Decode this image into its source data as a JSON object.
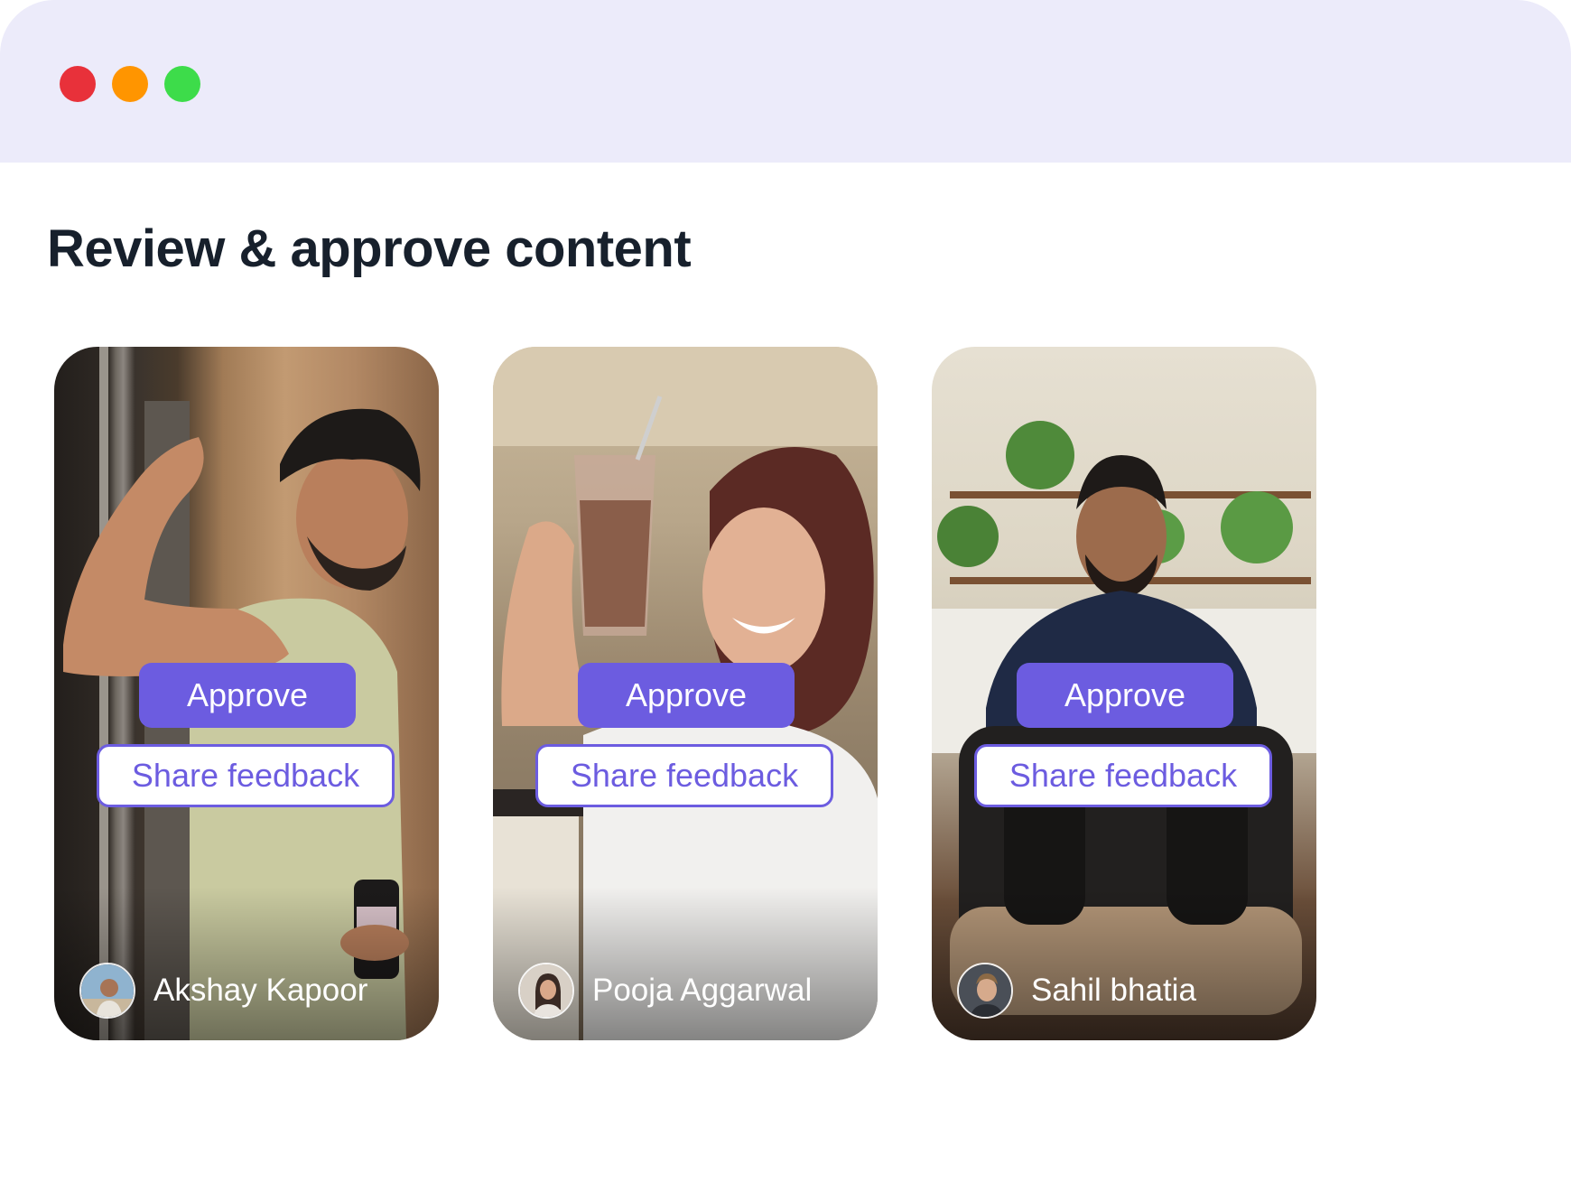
{
  "window": {
    "controls": [
      "close",
      "minimize",
      "maximize"
    ],
    "colors": {
      "titlebar": "#ecebfa",
      "close": "#e8313a",
      "minimize": "#ff9500",
      "maximize": "#3ddc4a"
    }
  },
  "page": {
    "title": "Review & approve content"
  },
  "colors": {
    "accent": "#6c5ce0",
    "title_text": "#17202c"
  },
  "cards": [
    {
      "approve_label": "Approve",
      "feedback_label": "Share feedback",
      "creator_name": "Akshay Kapoor"
    },
    {
      "approve_label": "Approve",
      "feedback_label": "Share feedback",
      "creator_name": "Pooja Aggarwal"
    },
    {
      "approve_label": "Approve",
      "feedback_label": "Share feedback",
      "creator_name": "Sahil bhatia"
    }
  ]
}
